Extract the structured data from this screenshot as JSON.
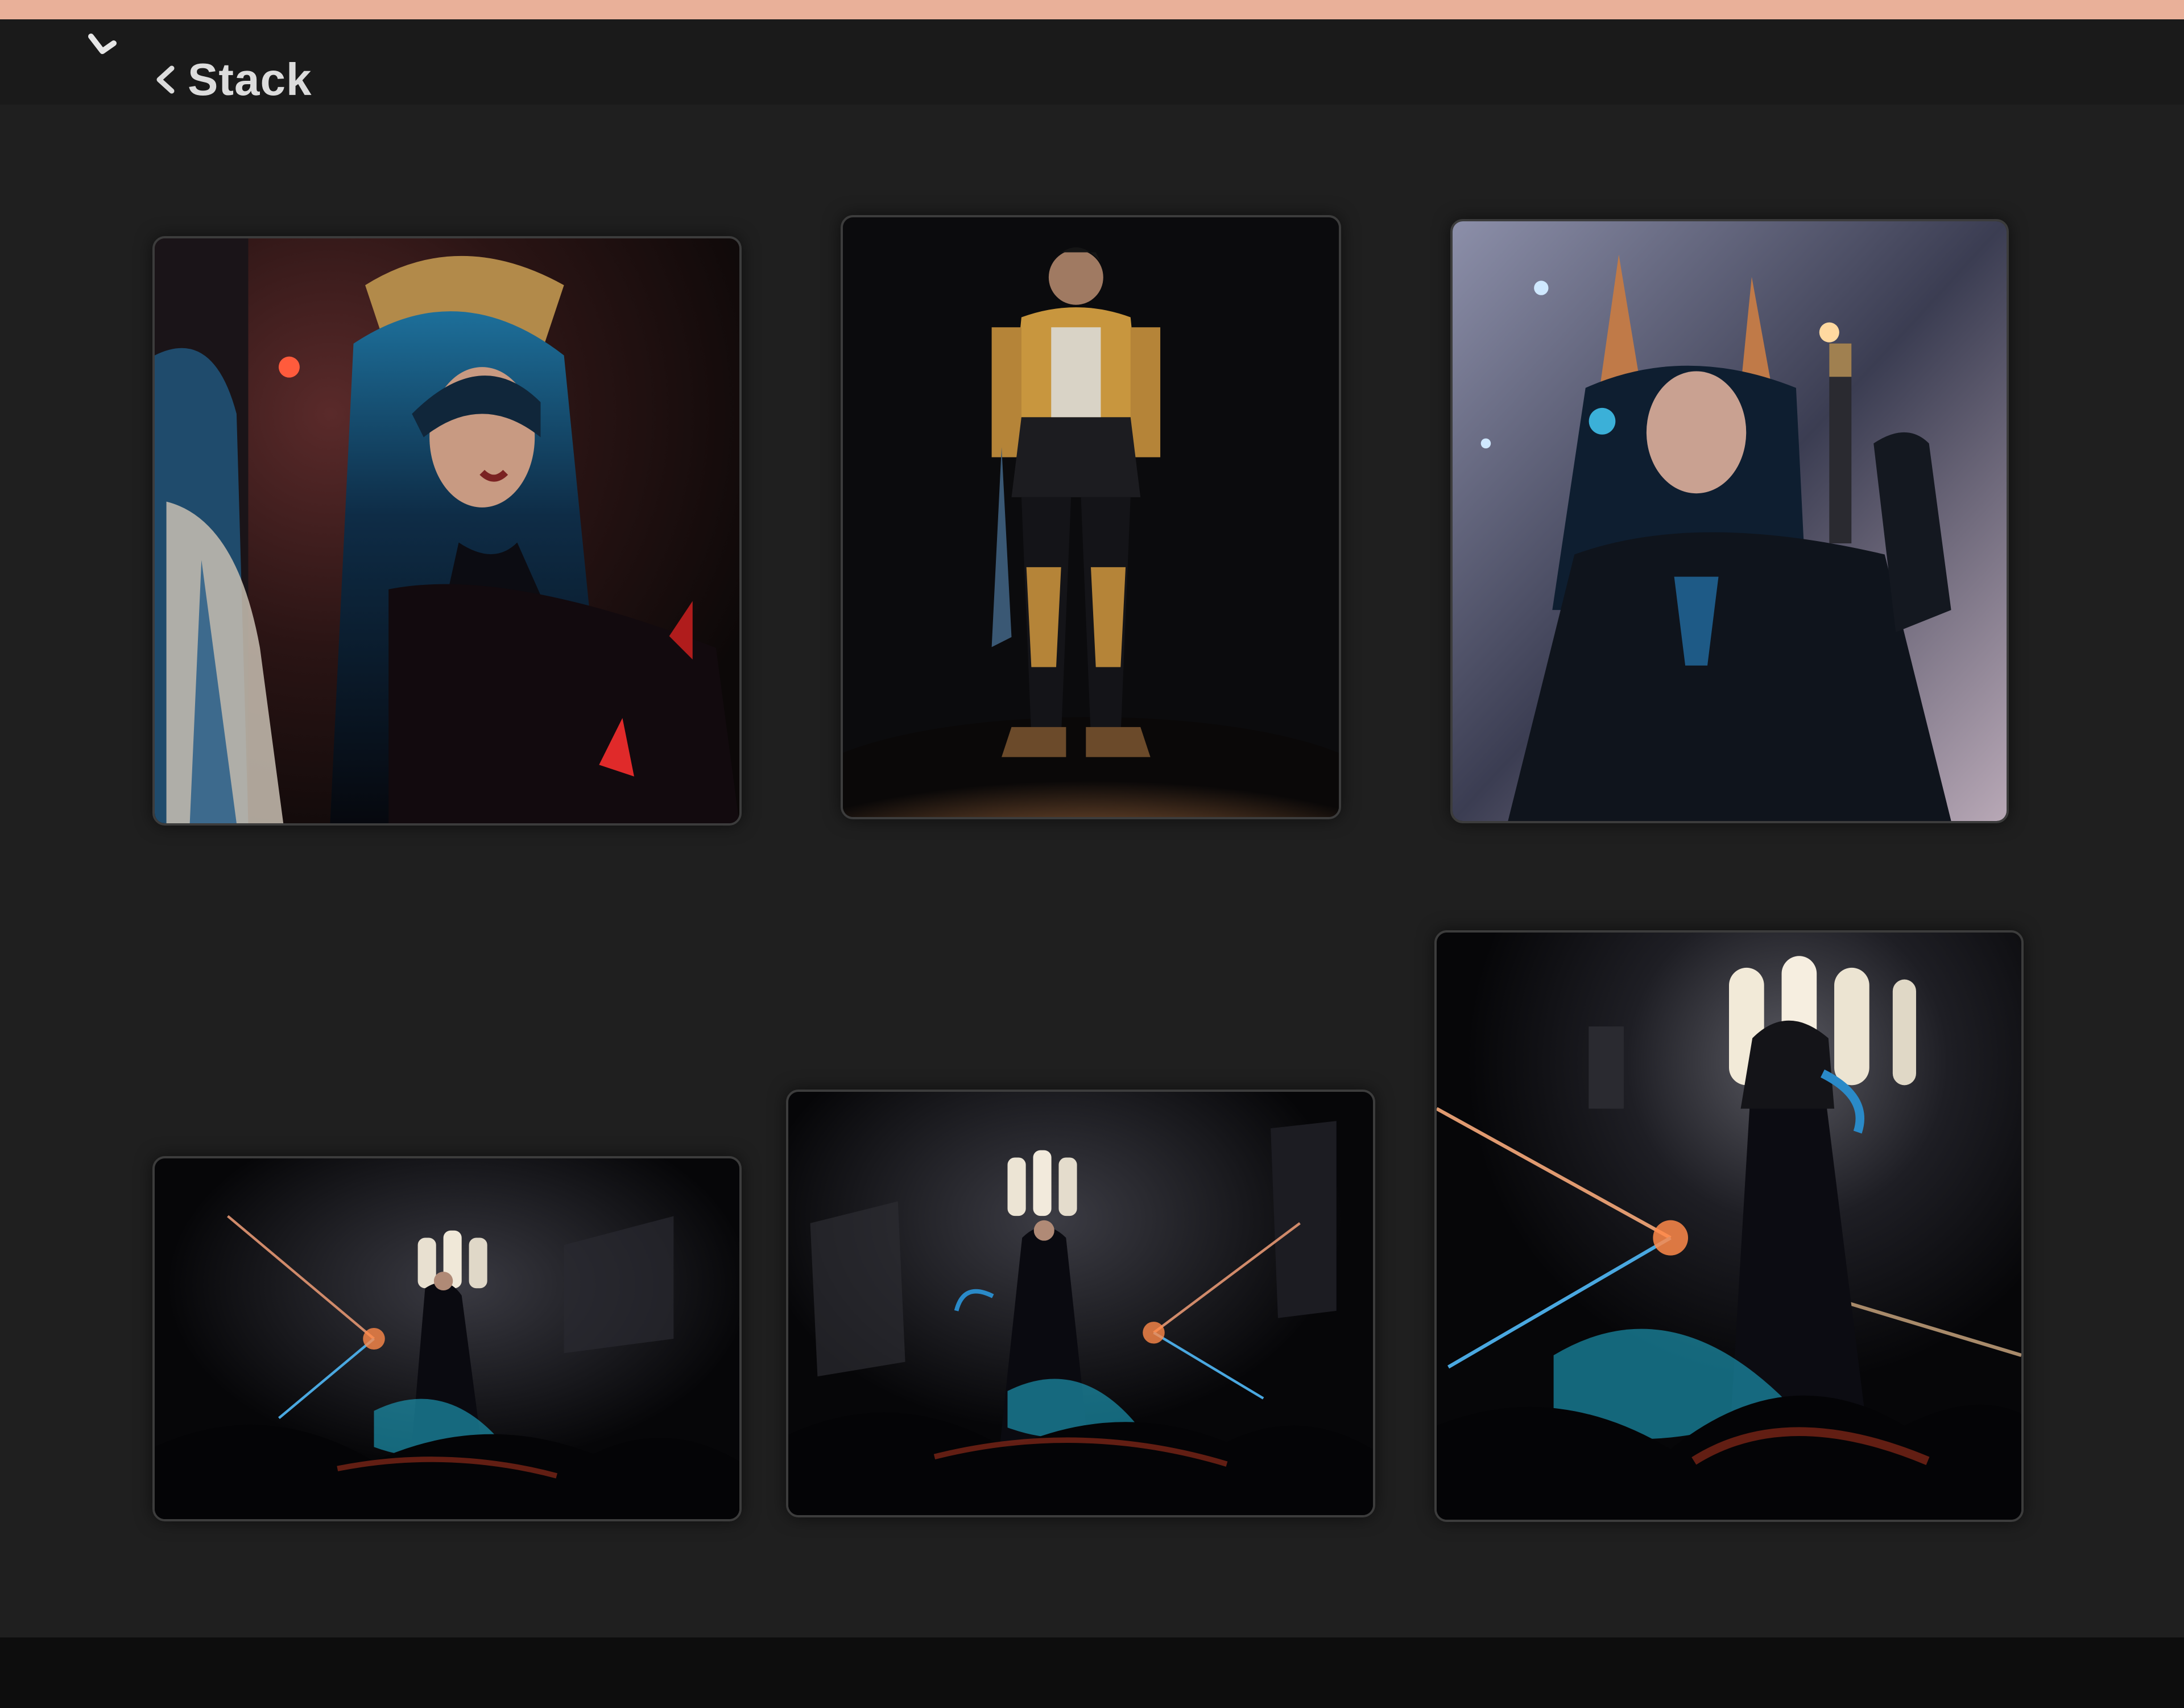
{
  "header": {
    "back_label": "Stack"
  },
  "gallery": {
    "images": [
      {
        "subject": "hooded-sorceress-portrait"
      },
      {
        "subject": "armored-knight-full-body"
      },
      {
        "subject": "crowned-woman-with-pistol"
      },
      {
        "subject": "sorceress-casting-in-cavern"
      },
      {
        "subject": "sorceress-casting-in-cavern"
      },
      {
        "subject": "sorceress-casting-in-cavern-closeup"
      }
    ]
  },
  "colors": {
    "top_accent": "#e9b099",
    "background": "#1f1f1f",
    "text": "#dcdcdc"
  }
}
